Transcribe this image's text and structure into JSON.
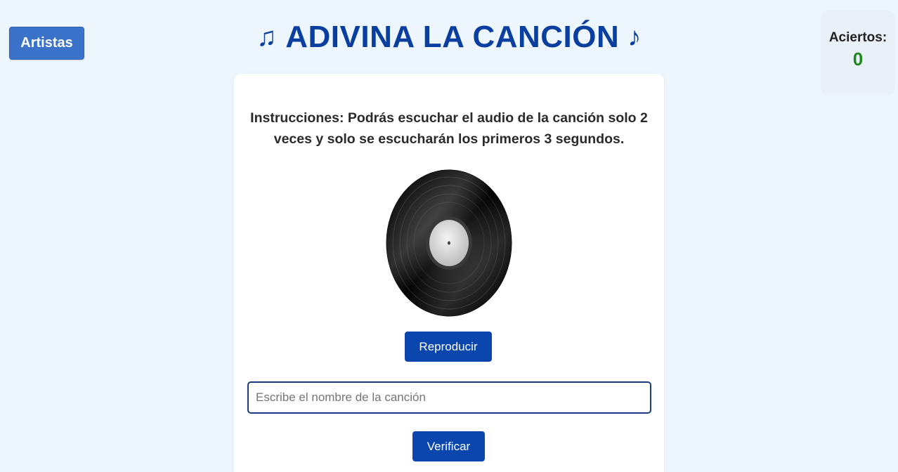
{
  "header": {
    "artists_label": "Artistas",
    "title_note_left": "♫",
    "title_text": "ADIVINA LA CANCIÓN",
    "title_note_right": "♪"
  },
  "score": {
    "label": "Aciertos:",
    "value": "0"
  },
  "card": {
    "instructions": "Instrucciones: Podrás escuchar el audio de la canción solo 2 veces y solo se escucharán los primeros 3 segundos.",
    "vinyl_icon": "vinyl-record-icon",
    "play_label": "Reproducir",
    "answer_placeholder": "Escribe el nombre de la canción",
    "answer_value": "",
    "verify_label": "Verificar"
  },
  "colors": {
    "background": "#eef6fd",
    "accent": "#0a46ad",
    "title": "#0a3fa0",
    "score": "#1e8a1e"
  }
}
